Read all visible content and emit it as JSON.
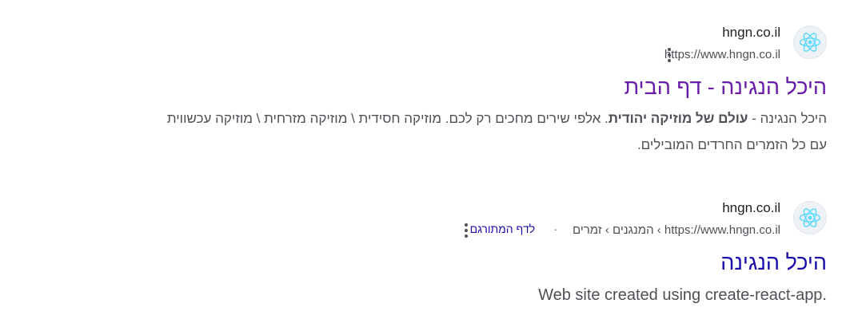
{
  "results": [
    {
      "site_name": "hngn.co.il",
      "url": "https://www.hngn.co.il",
      "title": "היכל הנגינה - דף הבית",
      "snippet": {
        "part1": "היכל הנגינה - ",
        "bold": "עולם של מוזיקה יהודית",
        "part2": ". אלפי שירים מחכים רק לכם. מוזיקה חסידית \\ מוזיקה מזרחית \\ מוזיקה עכשווית",
        "line2": "עם כל הזמרים החרדים המובילים."
      },
      "favicon_icon": "react-atom-icon"
    },
    {
      "site_name": "hngn.co.il",
      "url": "https://www.hngn.co.il › המנגנים › זמרים",
      "translated_link": "לדף המתורגם",
      "separator": "·",
      "title": "היכל הנגינה",
      "snippet": "Web site created using create-react-app.",
      "favicon_icon": "react-atom-icon"
    }
  ],
  "colors": {
    "visited_link": "#681da8",
    "unvisited_link": "#1a0dab",
    "text_secondary": "#4d5156",
    "text_primary": "#202124",
    "react_icon": "#61dafb"
  }
}
